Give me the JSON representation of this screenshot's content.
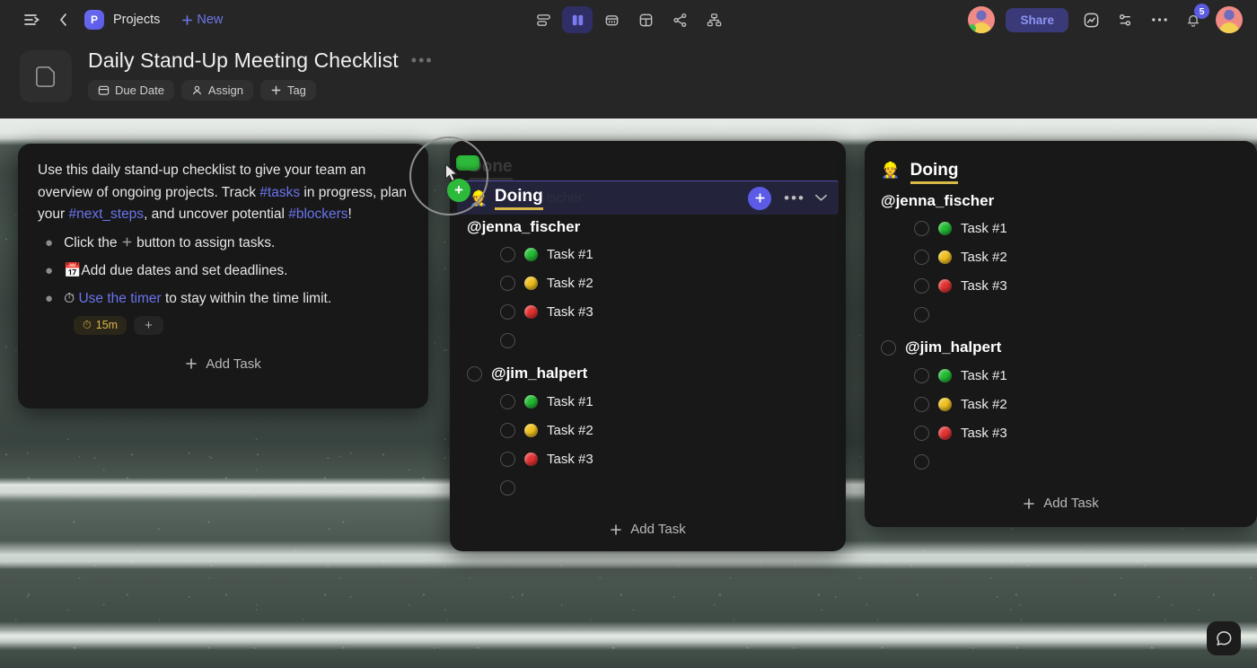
{
  "topbar": {
    "sidebar_toggle_icon": "sidebar-expand-icon",
    "back_icon": "chevron-left-icon",
    "project_initial": "P",
    "project_name": "Projects",
    "new_label": "New",
    "new_icon": "plus-icon",
    "views": [
      {
        "name": "list-view",
        "icon": "list-icon",
        "active": false
      },
      {
        "name": "board-view",
        "icon": "board-icon",
        "active": true
      },
      {
        "name": "calendar-view",
        "icon": "calendar-icon",
        "active": false
      },
      {
        "name": "table-view",
        "icon": "table-icon",
        "active": false
      },
      {
        "name": "share-graph-view",
        "icon": "share-nodes-icon",
        "active": false
      },
      {
        "name": "org-chart-view",
        "icon": "org-chart-icon",
        "active": false
      }
    ],
    "share_label": "Share",
    "activity_icon": "activity-chart-icon",
    "filter_icon": "sliders-icon",
    "more_icon": "ellipsis-icon",
    "bell_icon": "bell-icon",
    "notification_count": "5"
  },
  "doc_header": {
    "thumb_icon": "document-page-icon",
    "title": "Daily Stand-Up Meeting Checklist",
    "more_icon": "ellipsis-icon",
    "chips": [
      {
        "label": "Due Date",
        "icon": "calendar-icon"
      },
      {
        "label": "Assign",
        "icon": "person-icon"
      },
      {
        "label": "Tag",
        "icon": "plus-icon"
      }
    ]
  },
  "notes_card": {
    "paragraph": {
      "p1": "Use this daily stand-up checklist to give your team an overview of ongoing projects. Track ",
      "tag1": "#tasks",
      "p2": " in progress, plan your ",
      "tag2": "#next_steps",
      "p3": ", and uncover potential ",
      "tag3": "#blockers",
      "p4": "!"
    },
    "bullets": [
      {
        "emoji": "",
        "pre": "Click the ",
        "icon": "plus-icon",
        "post": " button to assign tasks."
      },
      {
        "emoji": "📅",
        "pre": "",
        "icon": "",
        "post": "Add due dates and set deadlines."
      },
      {
        "emoji": "⏱",
        "pre": "",
        "icon": "",
        "link": "Use the timer",
        "post": " to stay within the time limit."
      }
    ],
    "timer_pill": {
      "icon": "stopwatch-icon",
      "label": "15m"
    },
    "add_pill": "+",
    "add_task": "Add Task",
    "add_task_icon": "plus-icon"
  },
  "mid_card": {
    "ghost_column_title": "Done",
    "drag_row": {
      "title": "Doing",
      "emoji": "👷",
      "ghost_text": "ischer",
      "plus_icon": "plus-icon",
      "more_icon": "ellipsis-icon",
      "collapse_icon": "chevron-down-icon"
    },
    "groups": [
      {
        "owner": "@jenna_fischer",
        "owner_has_radio": false,
        "tasks": [
          {
            "label": "Task #1",
            "color": "#22bb33"
          },
          {
            "label": "Task #2",
            "color": "#f0c020"
          },
          {
            "label": "Task #3",
            "color": "#e23232"
          },
          {
            "label": "",
            "color": ""
          }
        ]
      },
      {
        "owner": "@jim_halpert",
        "owner_has_radio": true,
        "tasks": [
          {
            "label": "Task #1",
            "color": "#22bb33"
          },
          {
            "label": "Task #2",
            "color": "#f0c020"
          },
          {
            "label": "Task #3",
            "color": "#e23232"
          },
          {
            "label": "",
            "color": ""
          }
        ]
      }
    ],
    "add_task": "Add Task",
    "add_task_icon": "plus-icon"
  },
  "right_card": {
    "column_title": "Doing",
    "column_emoji": "👷",
    "groups": [
      {
        "owner": "@jenna_fischer",
        "owner_has_radio": false,
        "tasks": [
          {
            "label": "Task #1",
            "color": "#22bb33"
          },
          {
            "label": "Task #2",
            "color": "#f0c020"
          },
          {
            "label": "Task #3",
            "color": "#e23232"
          },
          {
            "label": "",
            "color": ""
          }
        ]
      },
      {
        "owner": "@jim_halpert",
        "owner_has_radio": true,
        "tasks": [
          {
            "label": "Task #1",
            "color": "#22bb33"
          },
          {
            "label": "Task #2",
            "color": "#f0c020"
          },
          {
            "label": "Task #3",
            "color": "#e23232"
          },
          {
            "label": "",
            "color": ""
          }
        ]
      }
    ],
    "add_task": "Add Task",
    "add_task_icon": "plus-icon"
  },
  "chat_fab": {
    "icon": "chat-bubble-icon"
  },
  "colors": {
    "accent_blue": "#5b5be6",
    "tag_blue": "#6a74ee",
    "underline_gold": "#d9b84a",
    "drag_green": "#2db93a",
    "panel_bg": "#181818",
    "chrome_bg": "#262626"
  }
}
